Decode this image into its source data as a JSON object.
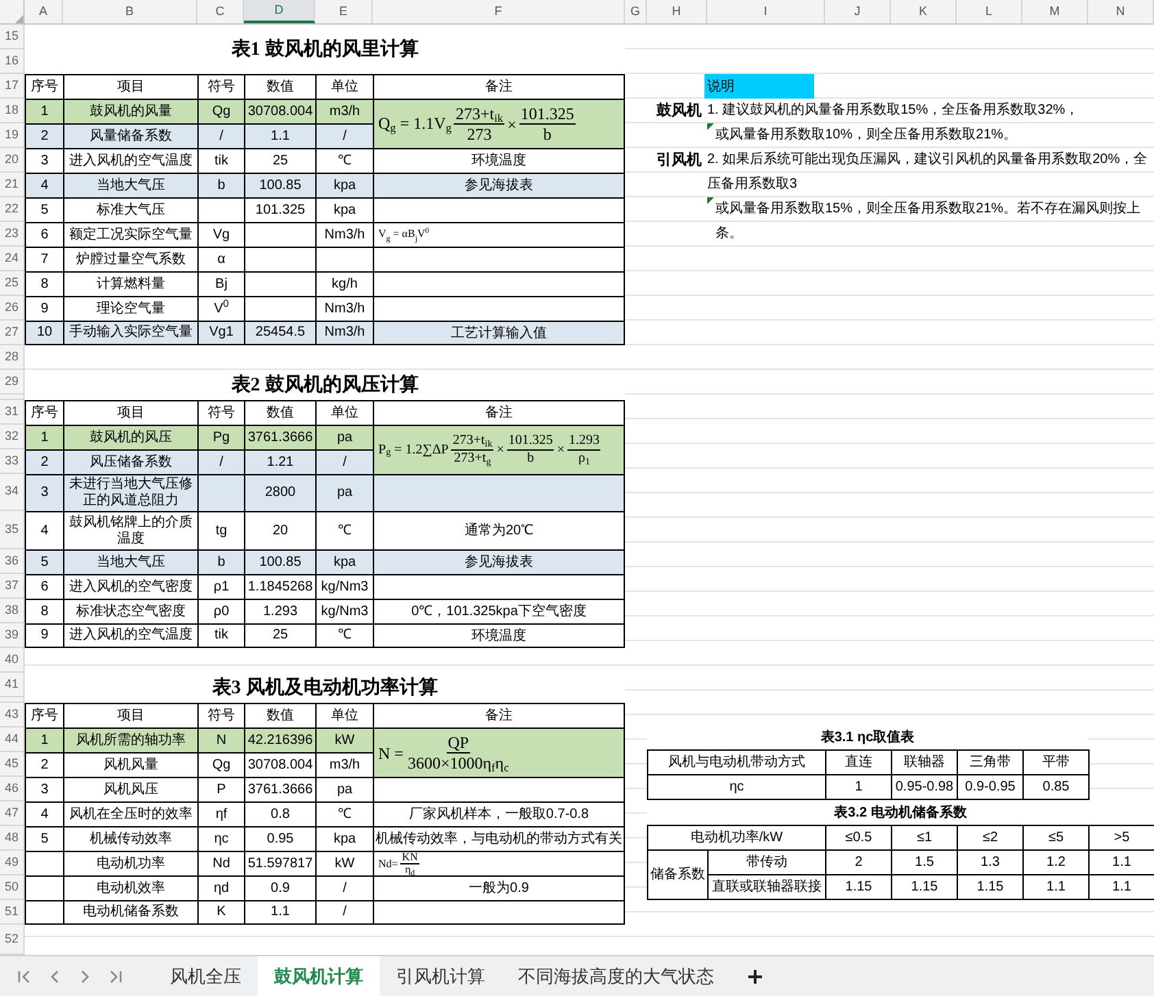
{
  "column_headers": [
    {
      "label": "A",
      "selected": false
    },
    {
      "label": "B",
      "selected": false
    },
    {
      "label": "C",
      "selected": false
    },
    {
      "label": "D",
      "selected": true
    },
    {
      "label": "E",
      "selected": false
    },
    {
      "label": "F",
      "selected": false
    },
    {
      "label": "G",
      "selected": false
    },
    {
      "label": "H",
      "selected": false
    },
    {
      "label": "I",
      "selected": false
    },
    {
      "label": "J",
      "selected": false
    },
    {
      "label": "K",
      "selected": false
    },
    {
      "label": "L",
      "selected": false
    },
    {
      "label": "M",
      "selected": false
    },
    {
      "label": "N",
      "selected": false
    }
  ],
  "row_numbers": [
    "15",
    "16",
    "17",
    "18",
    "19",
    "20",
    "21",
    "22",
    "23",
    "24",
    "25",
    "26",
    "27",
    "28",
    "29",
    "31",
    "32",
    "33",
    "34",
    "35",
    "36",
    "37",
    "38",
    "39",
    "40",
    "41",
    "43",
    "44",
    "45",
    "46",
    "47",
    "48",
    "49",
    "50",
    "51",
    "52"
  ],
  "tables": [
    {
      "title": "表1  鼓风机的风里计算",
      "header": [
        "序号",
        "项目",
        "符号",
        "数值",
        "单位",
        "备注"
      ],
      "rows": [
        {
          "no": "1",
          "item": "鼓风机的风量",
          "symbol": "Qg",
          "value": "30708.004",
          "unit": "m3/h",
          "color": "#c6e0b4",
          "formula": {
            "color": "#c6e0b4",
            "parts": [
              {
                "kind": "text",
                "text": "Q$_{g}$ = 1.1V$_{g}$"
              },
              {
                "kind": "frac",
                "num": "273+t$_{ik}$",
                "den": "273"
              },
              {
                "kind": "text",
                "text": "×"
              },
              {
                "kind": "frac",
                "num": "101.325",
                "den": "b"
              }
            ]
          }
        },
        {
          "no": "2",
          "item": "风量储备系数",
          "symbol": "/",
          "value": "1.1",
          "unit": "/",
          "color": "#dce6f1"
        },
        {
          "no": "3",
          "item": "进入风机的空气温度",
          "symbol": "tik",
          "value": "25",
          "unit": "℃",
          "note": "环境温度"
        },
        {
          "no": "4",
          "item": "当地大气压",
          "symbol": "b",
          "value": "100.85",
          "unit": "kpa",
          "color": "#dce6f1",
          "note": "参见海拔表"
        },
        {
          "no": "5",
          "item": "标准大气压",
          "value": "101.325",
          "unit": "kpa"
        },
        {
          "no": "6",
          "item": "额定工况实际空气量",
          "symbol": "Vg",
          "unit": "Nm3/h",
          "formula": {
            "parts": [
              {
                "kind": "text",
                "text": "V$_{g}$ = αB$_{j}$V$^{0}$"
              }
            ]
          }
        },
        {
          "no": "7",
          "item": "炉膛过量空气系数",
          "symbol": "α"
        },
        {
          "no": "8",
          "item": "计算燃料量",
          "symbol": "Bj",
          "unit": "kg/h"
        },
        {
          "no": "9",
          "item": "理论空气量",
          "symbol": "V$^{0}$",
          "unit": "Nm3/h"
        },
        {
          "no": "10",
          "item": "手动输入实际空气量",
          "symbol": "Vg1",
          "value": "25454.5",
          "unit": "Nm3/h",
          "color": "#dce6f1",
          "note": "工艺计算输入值"
        }
      ]
    },
    {
      "title": "表2  鼓风机的风压计算",
      "header": [
        "序号",
        "项目",
        "符号",
        "数值",
        "单位",
        "备注"
      ],
      "rows": [
        {
          "no": "1",
          "item": "鼓风机的风压",
          "symbol": "Pg",
          "value": "3761.3666",
          "unit": "pa",
          "color": "#c6e0b4",
          "formula": {
            "color": "#c6e0b4",
            "parts": [
              {
                "kind": "text",
                "text": "P$_{g}$ = 1.2∑ΔP"
              },
              {
                "kind": "frac",
                "num": "273+t$_{ik}$",
                "den": "273+t$_{g}$"
              },
              {
                "kind": "text",
                "text": "×"
              },
              {
                "kind": "frac",
                "num": "101.325",
                "den": "b"
              },
              {
                "kind": "text",
                "text": "×"
              },
              {
                "kind": "frac",
                "num": "1.293",
                "den": "ρ$_{1}$"
              }
            ]
          }
        },
        {
          "no": "2",
          "item": "风压储备系数",
          "symbol": "/",
          "value": "1.21",
          "unit": "/",
          "color": "#dce6f1"
        },
        {
          "no": "3",
          "item": "未进行当地大气压修正的风道总阻力",
          "value": "2800",
          "unit": "pa",
          "color": "#dce6f1"
        },
        {
          "no": "4",
          "item": "鼓风机铭牌上的介质温度",
          "symbol": "tg",
          "value": "20",
          "unit": "℃",
          "note": "通常为20℃"
        },
        {
          "no": "5",
          "item": "当地大气压",
          "symbol": "b",
          "value": "100.85",
          "unit": "kpa",
          "color": "#dce6f1",
          "note": "参见海拔表"
        },
        {
          "no": "6",
          "item": "进入风机的空气密度",
          "symbol": "ρ1",
          "value": "1.1845268",
          "unit": "kg/Nm3"
        },
        {
          "no": "8",
          "item": "标准状态空气密度",
          "symbol": "ρ0",
          "value": "1.293",
          "unit": "kg/Nm3",
          "note": "0℃，101.325kpa下空气密度"
        },
        {
          "no": "9",
          "item": "进入风机的空气温度",
          "symbol": "tik",
          "value": "25",
          "unit": "℃",
          "note": "环境温度"
        }
      ]
    },
    {
      "title": "表3  风机及电动机功率计算",
      "header": [
        "序号",
        "项目",
        "符号",
        "数值",
        "单位",
        "备注"
      ],
      "rows": [
        {
          "no": "1",
          "item": "风机所需的轴功率",
          "symbol": "N",
          "value": "42.216396",
          "unit": "kW",
          "color": "#c6e0b4",
          "formula": {
            "color": "#c6e0b4",
            "parts": [
              {
                "kind": "text",
                "text": "N ="
              },
              {
                "kind": "frac",
                "num": "QP",
                "den": "3600×1000η$_{f}$η$_{c}$"
              }
            ]
          }
        },
        {
          "no": "2",
          "item": "风机风量",
          "symbol": "Qg",
          "value": "30708.004",
          "unit": "m3/h"
        },
        {
          "no": "3",
          "item": "风机风压",
          "symbol": "P",
          "value": "3761.3666",
          "unit": "pa"
        },
        {
          "no": "4",
          "item": "风机在全压时的效率",
          "symbol": "ηf",
          "value": "0.8",
          "unit": "℃",
          "note": "厂家风机样本，一般取0.7-0.8"
        },
        {
          "no": "5",
          "item": "机械传动效率",
          "symbol": "ηc",
          "value": "0.95",
          "unit": "kpa",
          "note": "机械传动效率，与电动机的带动方式有关"
        },
        {
          "item": "电动机功率",
          "symbol": "Nd",
          "value": "51.597817",
          "unit": "kW",
          "formula": {
            "parts": [
              {
                "kind": "text",
                "text": "Nd="
              },
              {
                "kind": "frac",
                "num": "KN",
                "den": "η$_{d}$"
              }
            ]
          }
        },
        {
          "item": "电动机效率",
          "symbol": "ηd",
          "value": "0.9",
          "unit": "/",
          "note": "一般为0.9"
        },
        {
          "item": "电动机储备系数",
          "symbol": "K",
          "value": "1.1",
          "unit": "/"
        }
      ]
    }
  ],
  "notes": {
    "title": "说明",
    "items": [
      {
        "label": "鼓风机",
        "lines": [
          {
            "text": "1. 建议鼓风机的风量备用系数取15%，全压备用系数取32%，",
            "comment": false
          },
          {
            "text": "或风量备用系数取10%，则全压备用系数取21%。",
            "comment": true
          }
        ]
      },
      {
        "label": "引风机",
        "lines": [
          {
            "text": "2. 如果后系统可能出现负压漏风，建议引风机的风量备用系数取20%，全压备用系数取3",
            "comment": false
          },
          {
            "text": "或风量备用系数取15%，则全压备用系数取21%。若不存在漏风则按上条。",
            "comment": true
          }
        ]
      }
    ]
  },
  "table_3_1": {
    "title": "表3.1  ηc取值表",
    "rows": [
      [
        "风机与电动机带动方式",
        "直连",
        "联轴器",
        "三角带",
        "平带"
      ],
      [
        "ηc",
        "1",
        "0.95-0.98",
        "0.9-0.95",
        "0.85"
      ]
    ]
  },
  "table_3_2": {
    "title": "表3.2  电动机储备系数",
    "header": [
      "电动机功率/kW",
      "≤0.5",
      "≤1",
      "≤2",
      "≤5",
      ">5"
    ],
    "group_label": "储备系数",
    "rows": [
      [
        "带传动",
        "2",
        "1.5",
        "1.3",
        "1.2",
        "1.1"
      ],
      [
        "直联或联轴器联接",
        "1.15",
        "1.15",
        "1.15",
        "1.1",
        "1.1"
      ]
    ]
  },
  "sheet_tabs": [
    {
      "label": "风机全压",
      "selected": false
    },
    {
      "label": "鼓风机计算",
      "selected": true
    },
    {
      "label": "引风机计算",
      "selected": false
    },
    {
      "label": "不同海拔高度的大气状态",
      "selected": false
    }
  ]
}
